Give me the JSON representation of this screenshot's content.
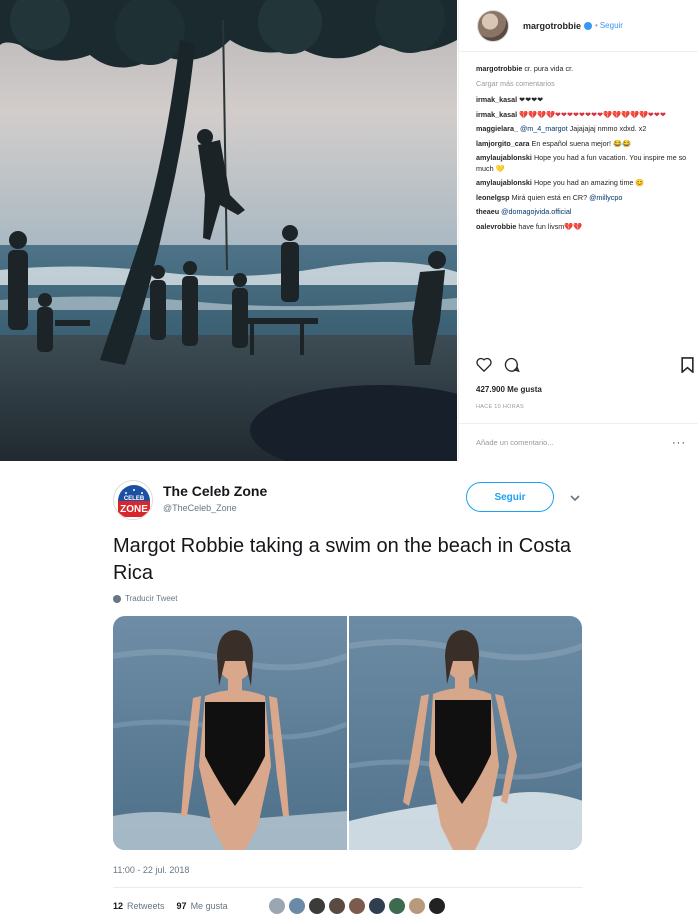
{
  "instagram": {
    "username": "margotrobbie",
    "follow_label": "Seguir",
    "caption_user": "margotrobbie",
    "caption_text": "cr. pura vida cr.",
    "load_more": "Cargar más comentarios",
    "comments": [
      {
        "user": "irmak_kasal",
        "text": "❤❤❤❤"
      },
      {
        "user": "irmak_kasal",
        "text": "💔💔💔💔❤❤❤❤❤❤❤❤💔💔💔💔💔❤❤❤"
      },
      {
        "user": "maggielara_",
        "mention": "@m_4_margot",
        "text": "Jajajajaj nmmo xdxd. x2"
      },
      {
        "user": "lamjorgito_cara",
        "text": "En español suena mejor! 😂😂"
      },
      {
        "user": "amylaujablonski",
        "text": "Hope you had a fun vacation. You inspire me so much 💛"
      },
      {
        "user": "amylaujablonski",
        "text": "Hope you had an amazing time 😊"
      },
      {
        "user": "leonelgsp",
        "text": "Mirá quien está en CR?",
        "mention_after": "@millycpo"
      },
      {
        "user": "theaeu",
        "mention": "@domagojvida.official",
        "text": ""
      },
      {
        "user": "oalevrobbie",
        "text": "have fun livsm💔💔"
      }
    ],
    "likes": "427.900 Me gusta",
    "date": "HACE 10 HORAS",
    "add_comment_placeholder": "Añade un comentario...",
    "more_options": "···"
  },
  "tweet": {
    "account_name": "The Celeb Zone",
    "handle": "@TheCeleb_Zone",
    "logo_text_top": "CELEB",
    "logo_text_bottom": "ZONE",
    "follow_label": "Seguir",
    "text": "Margot Robbie taking a swim on the beach in Costa Rica",
    "translate": "Traducir Tweet",
    "timestamp": "11:00 - 22 jul. 2018",
    "retweets_count": "12",
    "retweets_label": "Retweets",
    "likes_count": "97",
    "likes_label": "Me gusta"
  },
  "colors": {
    "twitter_blue": "#1da1f2",
    "instagram_link": "#3897f0",
    "heart_red": "#d6303e"
  }
}
